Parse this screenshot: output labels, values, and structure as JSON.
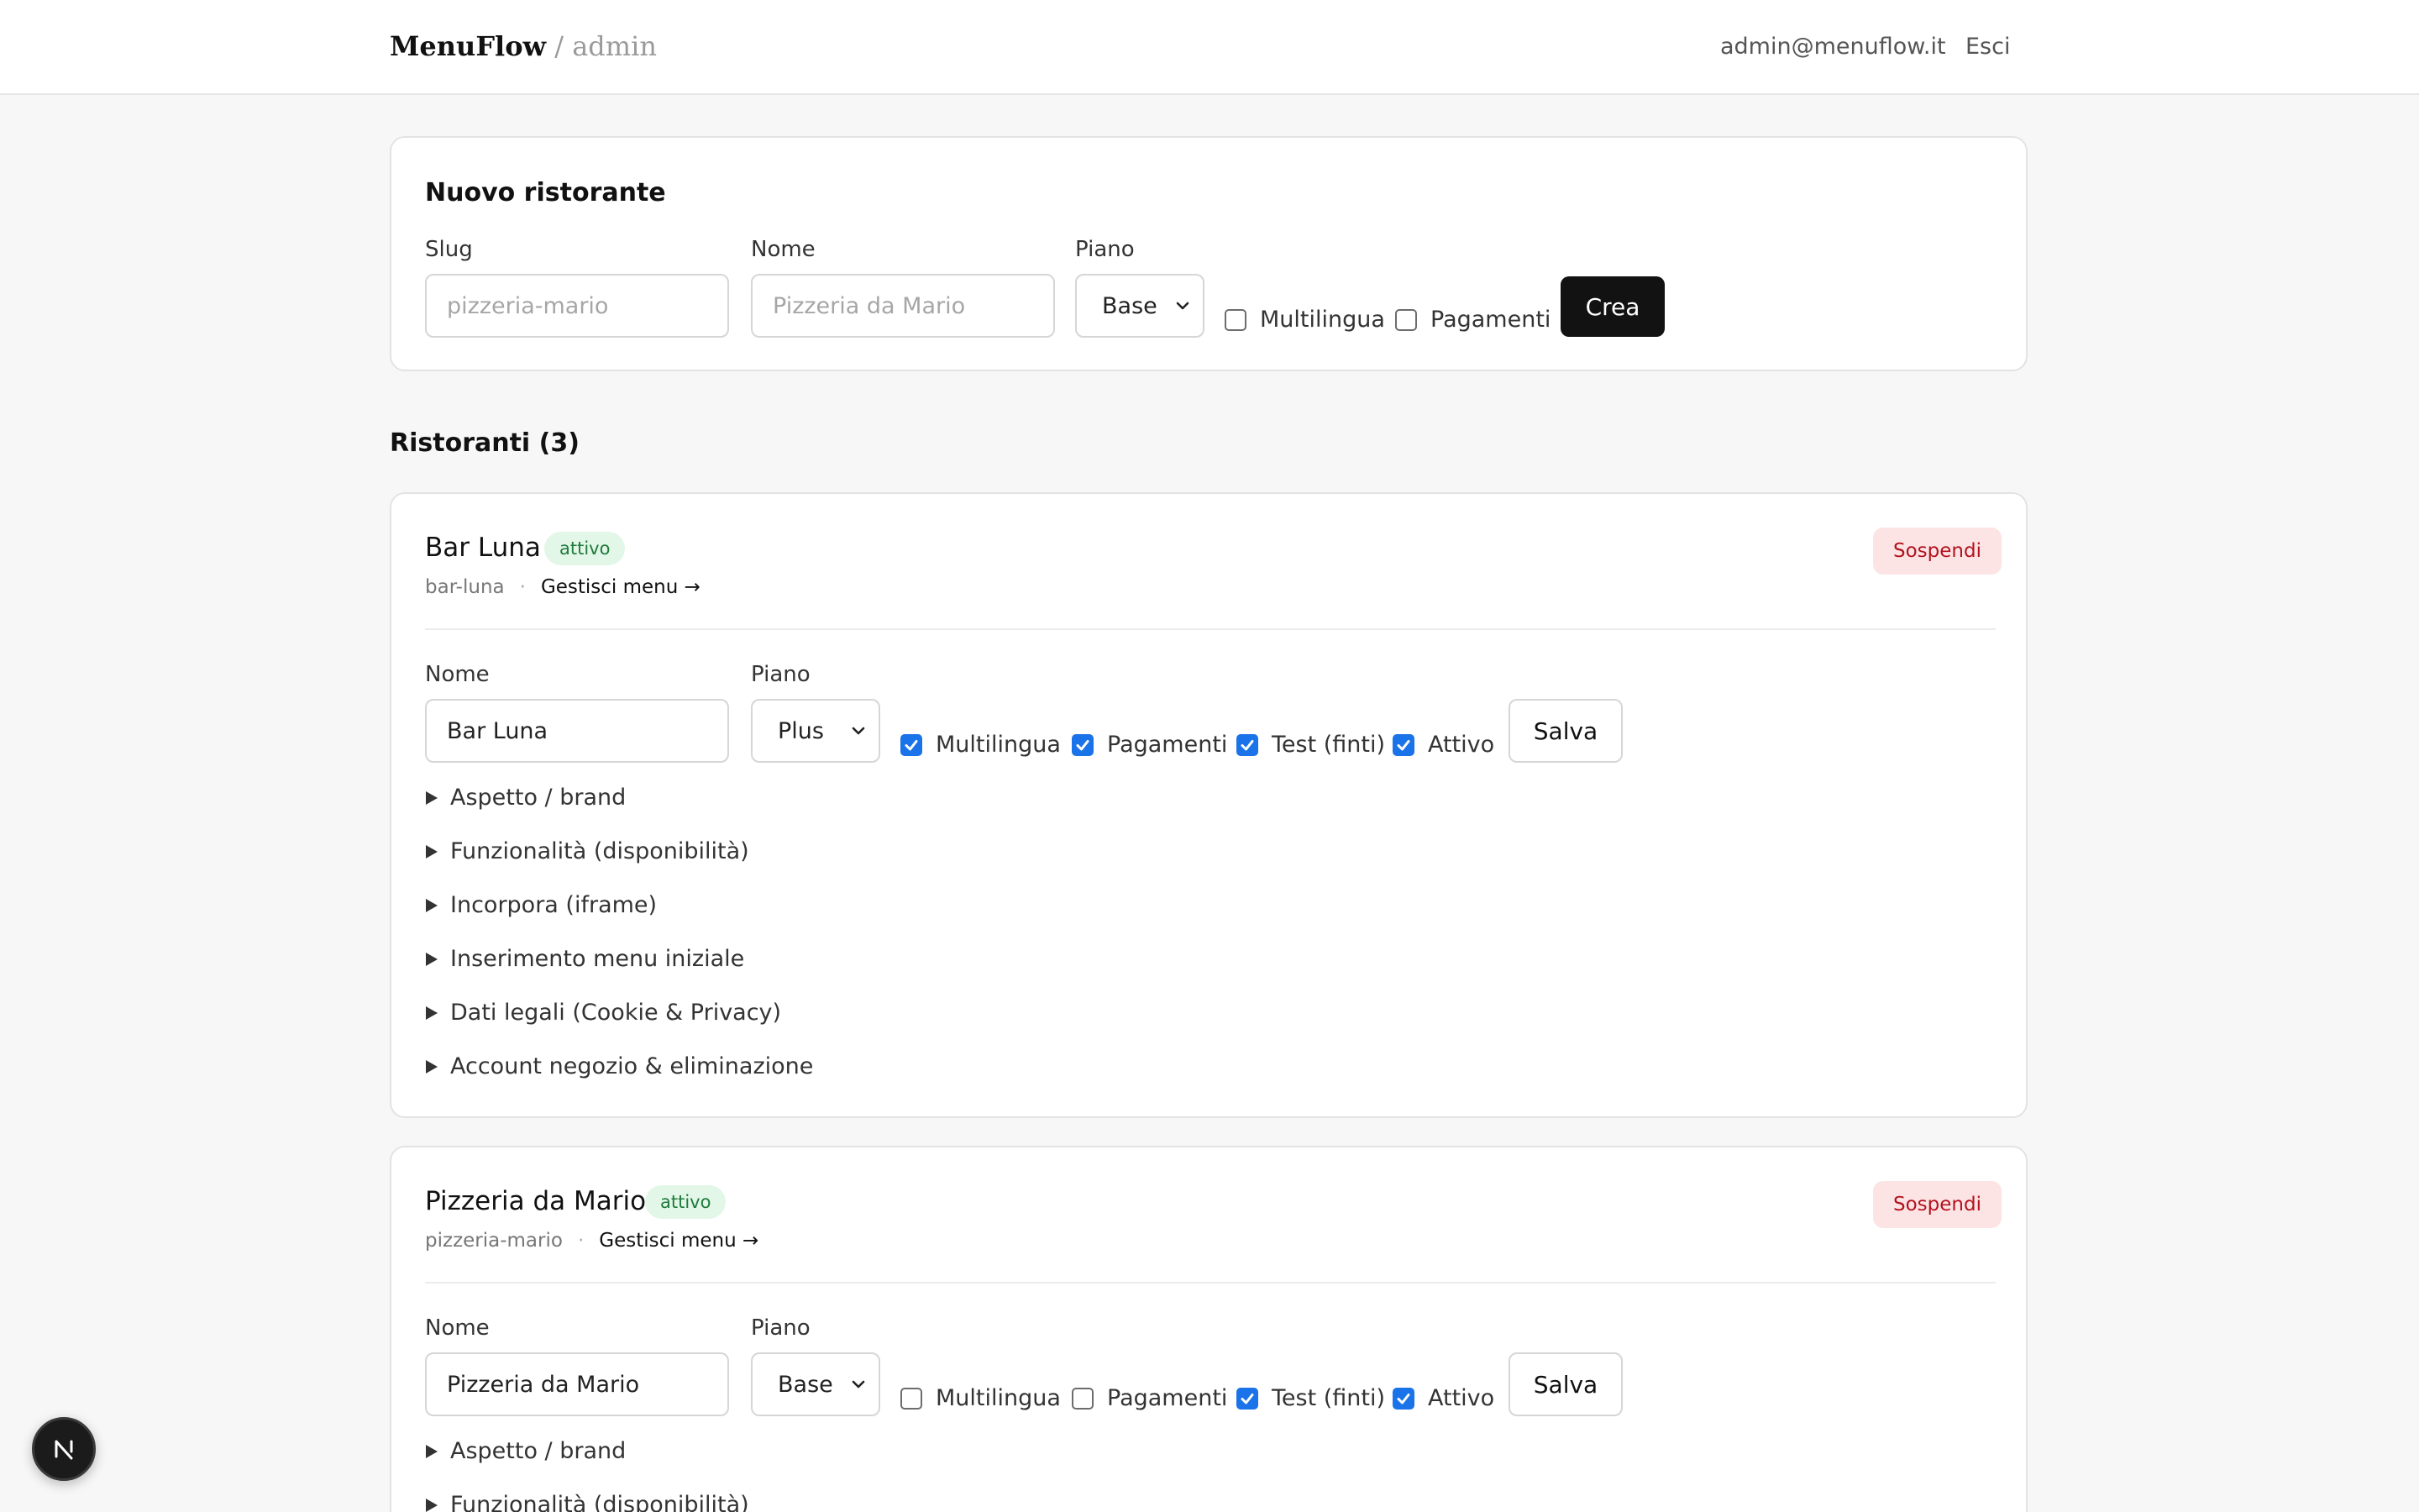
{
  "header": {
    "brand": "MenuFlow",
    "brand_sub": " / admin",
    "user_email": "admin@menuflow.it",
    "logout_label": "Esci"
  },
  "new_restaurant": {
    "title": "Nuovo ristorante",
    "slug_label": "Slug",
    "slug_placeholder": "pizzeria-mario",
    "name_label": "Nome",
    "name_placeholder": "Pizzeria da Mario",
    "plan_label": "Piano",
    "plan_value": "Base",
    "multilingual_label": "Multilingua",
    "multilingual_checked": false,
    "payments_label": "Pagamenti",
    "payments_checked": false,
    "create_label": "Crea"
  },
  "restaurants_title": "Ristoranti (3)",
  "restaurants": [
    {
      "name": "Bar Luna",
      "status": "attivo",
      "slug": "bar-luna",
      "manage_label": "Gestisci menu →",
      "suspend_label": "Sospendi",
      "name_label": "Nome",
      "name_value": "Bar Luna",
      "plan_label": "Piano",
      "plan_value": "Plus",
      "checks": [
        {
          "label": "Multilingua",
          "checked": true
        },
        {
          "label": "Pagamenti",
          "checked": true
        },
        {
          "label": "Test (finti)",
          "checked": true
        },
        {
          "label": "Attivo",
          "checked": true
        }
      ],
      "save_label": "Salva",
      "sections": [
        "Aspetto / brand",
        "Funzionalità (disponibilità)",
        "Incorpora (iframe)",
        "Inserimento menu iniziale",
        "Dati legali (Cookie & Privacy)",
        "Account negozio & eliminazione"
      ]
    },
    {
      "name": "Pizzeria da Mario",
      "status": "attivo",
      "slug": "pizzeria-mario",
      "manage_label": "Gestisci menu →",
      "suspend_label": "Sospendi",
      "name_label": "Nome",
      "name_value": "Pizzeria da Mario",
      "plan_label": "Piano",
      "plan_value": "Base",
      "checks": [
        {
          "label": "Multilingua",
          "checked": false
        },
        {
          "label": "Pagamenti",
          "checked": false
        },
        {
          "label": "Test (finti)",
          "checked": true
        },
        {
          "label": "Attivo",
          "checked": true
        }
      ],
      "save_label": "Salva",
      "sections": [
        "Aspetto / brand",
        "Funzionalità (disponibilità)"
      ]
    }
  ],
  "colors": {
    "accent": "#1a73e8",
    "danger": "#b3121f",
    "success": "#1f7a3c"
  },
  "icons": {
    "dev_badge": "nextjs-logo-icon"
  }
}
